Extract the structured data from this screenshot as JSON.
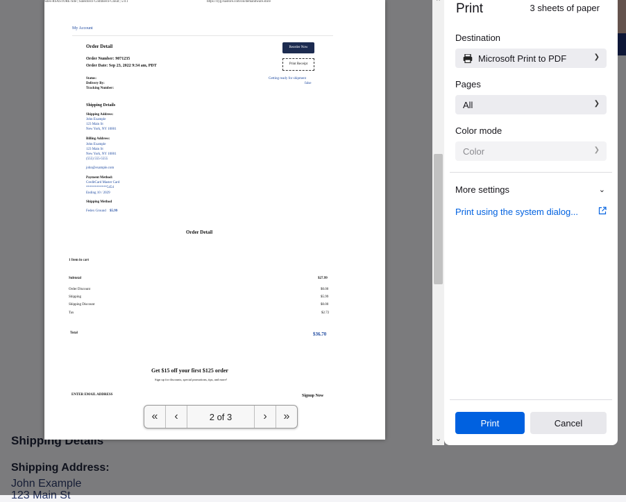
{
  "background": {
    "shipping_heading": "Shipping Details",
    "shipping_address_label": "Shipping Address:",
    "name": "John Example",
    "street": "123 Main St"
  },
  "preview": {
    "header_left": "Sites-RSASTORE-Site | Salesforce Commerce Cloud | 5.0.1",
    "header_url": "https://zyg.rsastore.com/on/demandware.store",
    "my_account": "My Account",
    "order_detail_title": "Order Detail",
    "order_number": "Order Number: 9071235",
    "order_date": "Order Date: Sep 23, 2022 9:34 am, PDT",
    "reorder_button": "Reorder Now",
    "print_receipt_button": "Print Receipt",
    "status_label": "Status:",
    "delivery_label": "Delivery By:",
    "tracking_label": "Tracking Number:",
    "status_value": "Getting ready for shipment",
    "tracking_value": "false",
    "shipping_details": "Shipping Details",
    "shipping_address_label": "Shipping Address:",
    "ship_name": "John Example",
    "ship_street": "123 Main St",
    "ship_city": "New York, NY 10001",
    "billing_address_label": "Billing Address:",
    "bill_name": "John Example",
    "bill_street": "123 Main St",
    "bill_city": "New York, NY 10001",
    "bill_phone": "(555) 555-5555",
    "email": "john@example.com",
    "payment_method_label": "Payment Method:",
    "card_type": "CreditCard Master Card",
    "card_number": "************5454",
    "card_expiry": "Ending 10 / 2029",
    "shipping_method_label": "Shipping Method",
    "shipping_method_value": "Fedex Ground",
    "shipping_method_price": "$5.99",
    "order_detail_center": "Order Detail",
    "items_in_cart": "1 Item in cart",
    "totals": [
      {
        "label": "Subtotal",
        "value": "$27.99"
      },
      {
        "label": "Order Discount",
        "value": "$0.00"
      },
      {
        "label": "Shipping",
        "value": "$5.99"
      },
      {
        "label": "Shipping Discount",
        "value": "$0.00"
      },
      {
        "label": "Tax",
        "value": "$2.72"
      }
    ],
    "total_label": "Total",
    "total_value": "$36.70",
    "promo_title": "Get $15 off your first $125 order",
    "promo_sub": "Sign up for discounts, special promotions, tips, and more!",
    "email_placeholder": "ENTER EMAIL ADDRESS",
    "signup": "Signup Now"
  },
  "pager": {
    "first": "«",
    "prev": "‹",
    "page": "2 of 3",
    "next": "›",
    "last": "»"
  },
  "panel": {
    "title": "Print",
    "sheets": "3 sheets of paper",
    "destination_label": "Destination",
    "destination_value": "Microsoft Print to PDF",
    "pages_label": "Pages",
    "pages_value": "All",
    "color_label": "Color mode",
    "color_value": "Color",
    "more_settings": "More settings",
    "system_dialog": "Print using the system dialog...",
    "print_button": "Print",
    "cancel_button": "Cancel"
  },
  "icons": {
    "printer": "printer-icon",
    "chevron": "chevron-down-icon",
    "external": "external-link-icon"
  }
}
